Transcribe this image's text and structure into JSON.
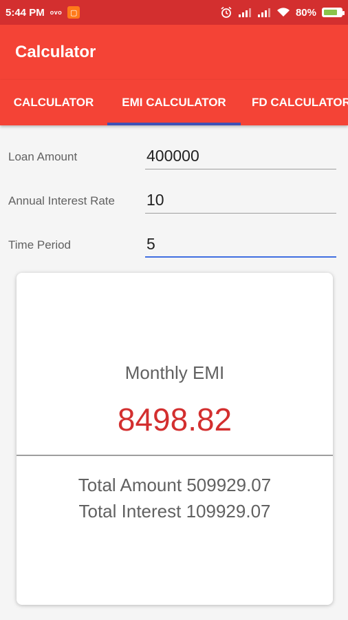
{
  "status_bar": {
    "time": "5:44 PM",
    "carrier_label": "ovo",
    "battery_percent": "80%",
    "icons": [
      "alarm-icon",
      "signal-icon",
      "signal-icon",
      "wifi-icon",
      "battery-charging-icon"
    ],
    "battery_level": 0.8
  },
  "app_bar": {
    "title": "Calculator"
  },
  "tabs": [
    {
      "label": "CALCULATOR",
      "selected": false
    },
    {
      "label": "EMI CALCULATOR",
      "selected": true
    },
    {
      "label": "FD CALCULATOR",
      "selected": false
    }
  ],
  "form": {
    "loan_amount": {
      "label": "Loan Amount",
      "value": "400000"
    },
    "interest_rate": {
      "label": "Annual Interest Rate",
      "value": "10"
    },
    "time_period": {
      "label": "Time Period",
      "value": "5"
    }
  },
  "result": {
    "emi_label": "Monthly EMI",
    "emi_value": "8498.82",
    "total_amount_label": "Total Amount",
    "total_amount_value": "509929.07",
    "total_interest_label": "Total Interest",
    "total_interest_value": "109929.07"
  },
  "colors": {
    "primary": "#f44336",
    "primary_dark": "#d32f2f",
    "tab_indicator": "#3f51b5",
    "emi_value": "#d32f2f"
  }
}
